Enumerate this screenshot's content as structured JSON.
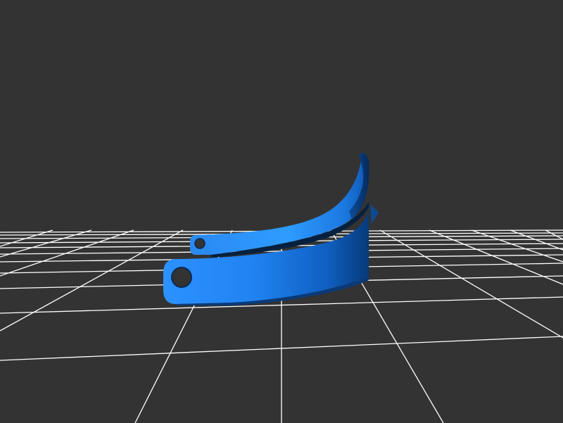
{
  "viewer": {
    "background_color": "#333333",
    "grid_color": "#ffffff",
    "model_colors": {
      "light": "#2f9bff",
      "mid": "#1f7be8",
      "dark": "#0b4f9e",
      "shadow": "#0a2a55"
    },
    "grid_on": true,
    "model_icon": "curved-bracket-model"
  }
}
